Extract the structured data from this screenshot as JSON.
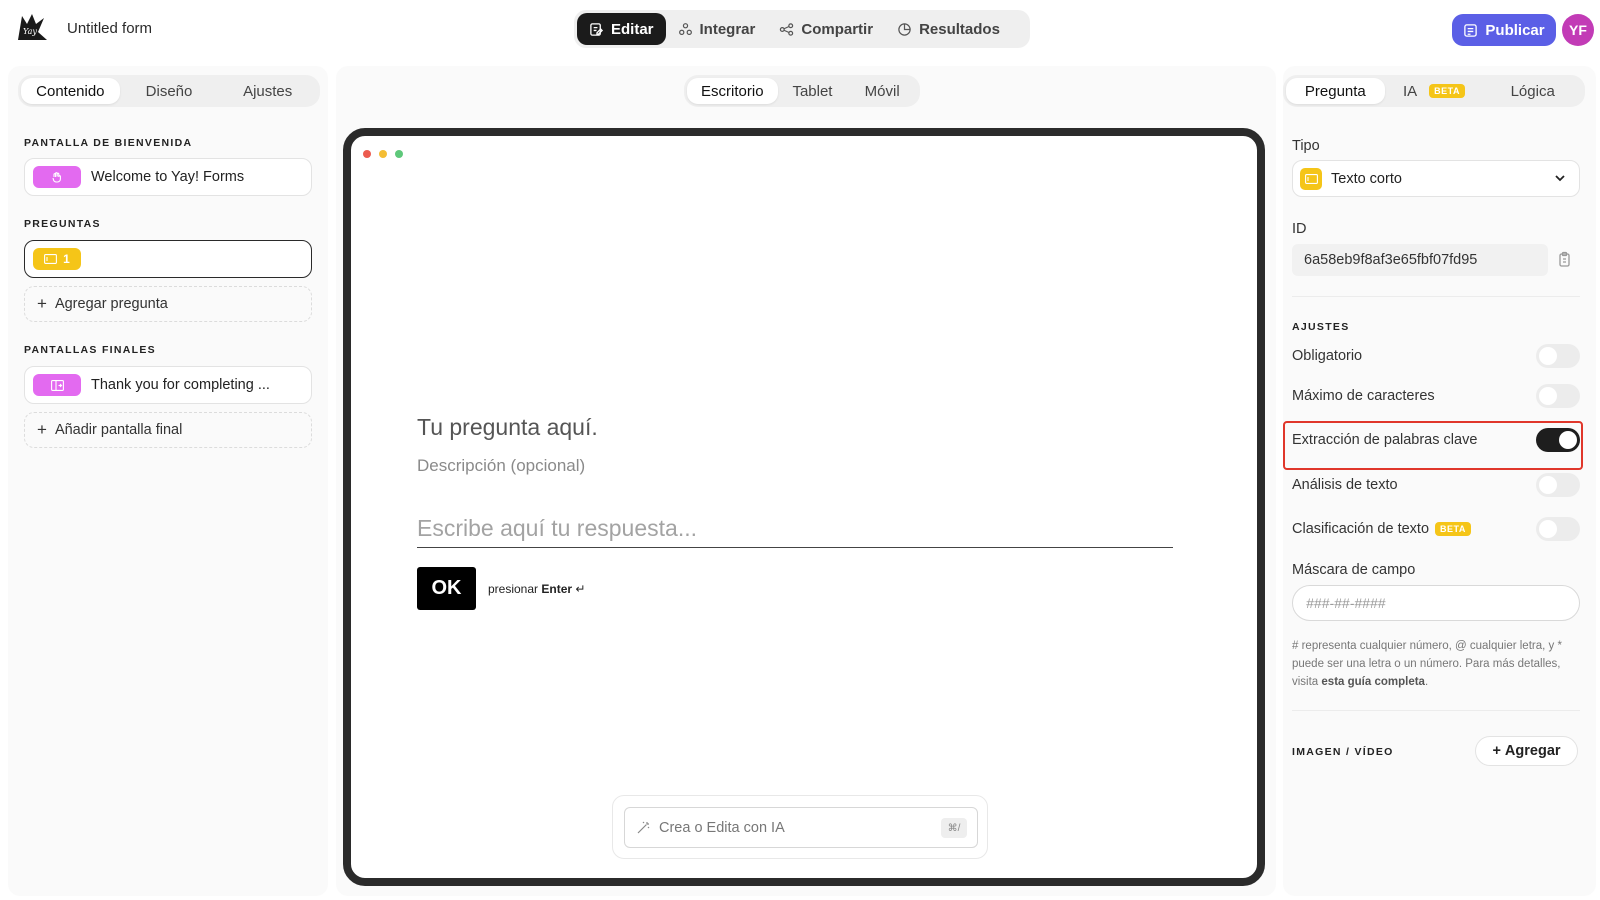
{
  "header": {
    "form_title": "Untitled form",
    "modes": [
      {
        "label": "Editar",
        "icon": "edit-icon"
      },
      {
        "label": "Integrar",
        "icon": "integrate-icon"
      },
      {
        "label": "Compartir",
        "icon": "share-icon"
      },
      {
        "label": "Resultados",
        "icon": "results-icon"
      }
    ],
    "publish_label": "Publicar",
    "avatar_initials": "YF",
    "brand_color": "#5b5fe6"
  },
  "left": {
    "tabs": [
      "Contenido",
      "Diseño",
      "Ajustes"
    ],
    "welcome_label": "PANTALLA DE BIENVENIDA",
    "welcome_item": "Welcome to Yay! Forms",
    "questions_label": "PREGUNTAS",
    "question_number": "1",
    "add_question": "Agregar pregunta",
    "endings_label": "PANTALLAS FINALES",
    "ending_item": "Thank you for completing ...",
    "add_ending": "Añadir pantalla final"
  },
  "center": {
    "device_tabs": [
      "Escritorio",
      "Tablet",
      "Móvil"
    ],
    "question_title": "Tu pregunta aquí.",
    "question_desc": "Descripción (opcional)",
    "answer_placeholder": "Escribe aquí tu respuesta...",
    "ok_label": "OK",
    "enter_prefix": "presionar",
    "enter_key": "Enter",
    "ai_placeholder": "Crea o Edita con IA",
    "ai_shortcut": "⌘/"
  },
  "right": {
    "tabs": [
      "Pregunta",
      "IA",
      "Lógica"
    ],
    "beta_label": "BETA",
    "type_label": "Tipo",
    "type_value": "Texto corto",
    "id_label": "ID",
    "id_value": "6a58eb9f8af3e65fbf07fd95",
    "settings_label": "AJUSTES",
    "settings": [
      {
        "label": "Obligatorio",
        "on": false
      },
      {
        "label": "Máximo de caracteres",
        "on": false
      },
      {
        "label": "Extracción de palabras clave",
        "on": true
      },
      {
        "label": "Análisis de texto",
        "on": false
      },
      {
        "label": "Clasificación de texto",
        "on": false,
        "beta": true
      }
    ],
    "mask_label": "Máscara de campo",
    "mask_placeholder": "###-##-####",
    "help_text": "# representa cualquier número, @ cualquier letra, y * puede ser una letra o un número. Para más detalles, visita",
    "help_link": "esta guía completa",
    "media_label": "IMAGEN / VÍDEO",
    "add_label": "Agregar"
  }
}
